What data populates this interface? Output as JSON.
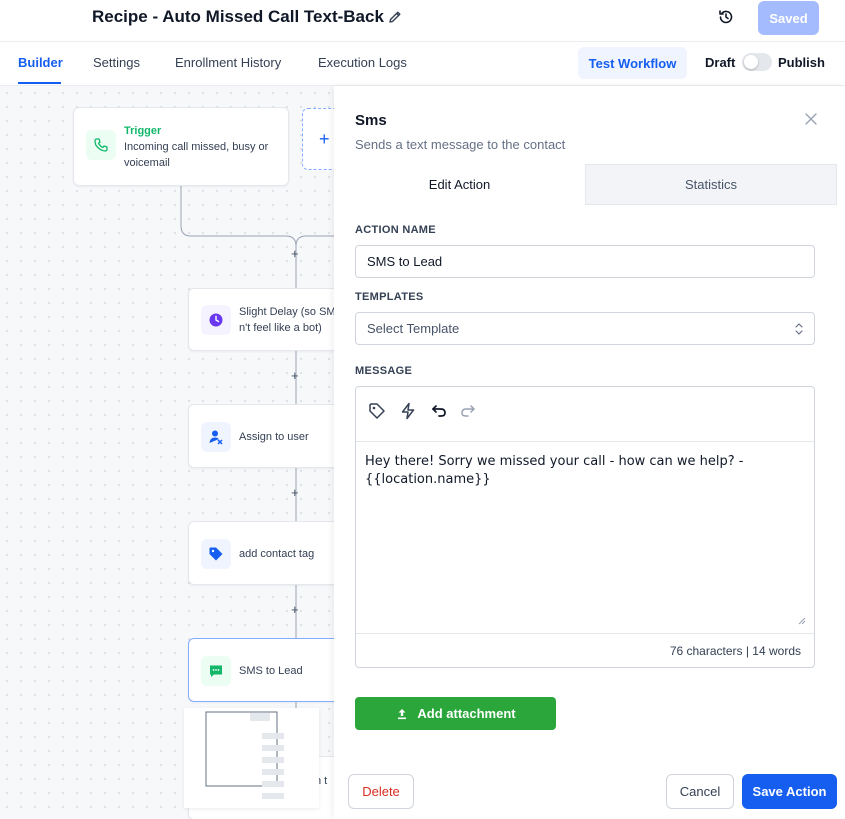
{
  "header": {
    "title": "Recipe - Auto Missed Call Text-Back",
    "saved_label": "Saved"
  },
  "tabs": {
    "items": [
      "Builder",
      "Settings",
      "Enrollment History",
      "Execution Logs"
    ],
    "active": "Builder",
    "test_workflow_label": "Test Workflow",
    "draft_label": "Draft",
    "publish_label": "Publish",
    "publish_toggle_on": false
  },
  "canvas": {
    "trigger": {
      "label": "Trigger",
      "description": "Incoming call missed, busy or voicemail",
      "icon": "phone-icon"
    },
    "actions": [
      {
        "label": "Slight Delay (so SMS doesn't feel like a bot)",
        "visible_text": "Slight Delay (so SM n't feel like a bot)",
        "icon": "clock-icon",
        "icon_color": "#6938ef"
      },
      {
        "label": "Assign to user",
        "icon": "user-assign-icon",
        "icon_color": "#155eef"
      },
      {
        "label": "add contact tag",
        "icon": "tag-icon",
        "icon_color": "#155eef"
      },
      {
        "label": "SMS to Lead",
        "icon": "sms-icon",
        "icon_color": "#12b76a"
      }
    ],
    "partial_next_text": "n t"
  },
  "panel": {
    "title": "Sms",
    "subtitle": "Sends a text message to the contact",
    "tabs": [
      "Edit Action",
      "Statistics"
    ],
    "action_name_label": "ACTION NAME",
    "action_name_value": "SMS to Lead",
    "templates_label": "TEMPLATES",
    "templates_placeholder": "Select Template",
    "message_label": "MESSAGE",
    "message_text_line1": "Hey there! Sorry we missed your call - how can we help? -",
    "message_text_line2": "{{location.name}}",
    "counter": "76 characters | 14 words",
    "attach_label": "Add attachment",
    "delete_label": "Delete",
    "cancel_label": "Cancel",
    "save_label": "Save Action"
  },
  "colors": {
    "primary": "#155eef",
    "success": "#2aa63b",
    "danger": "#d92d20",
    "saved_disabled": "#a4bcfd"
  }
}
